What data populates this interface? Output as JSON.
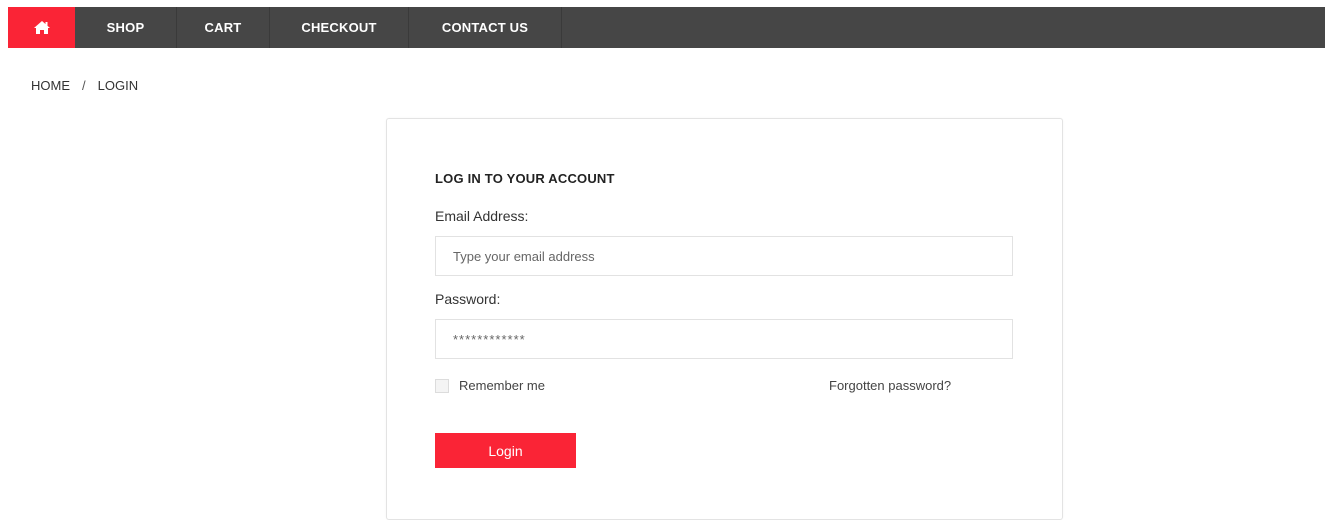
{
  "nav": {
    "home_icon": "home-icon",
    "items": [
      {
        "label": "SHOP"
      },
      {
        "label": "CART"
      },
      {
        "label": "CHECKOUT"
      },
      {
        "label": "CONTACT US"
      }
    ]
  },
  "breadcrumb": {
    "home": "HOME",
    "separator": "/",
    "current": "LOGIN"
  },
  "login": {
    "title": "LOG IN TO YOUR ACCOUNT",
    "email_label": "Email Address:",
    "email_placeholder": "Type your email address",
    "email_value": "",
    "password_label": "Password:",
    "password_placeholder": "************",
    "password_value": "",
    "remember_label": "Remember me",
    "remember_checked": false,
    "forgot_label": "Forgotten password?",
    "submit_label": "Login"
  },
  "colors": {
    "accent": "#fa2436",
    "nav_background": "#464646"
  }
}
